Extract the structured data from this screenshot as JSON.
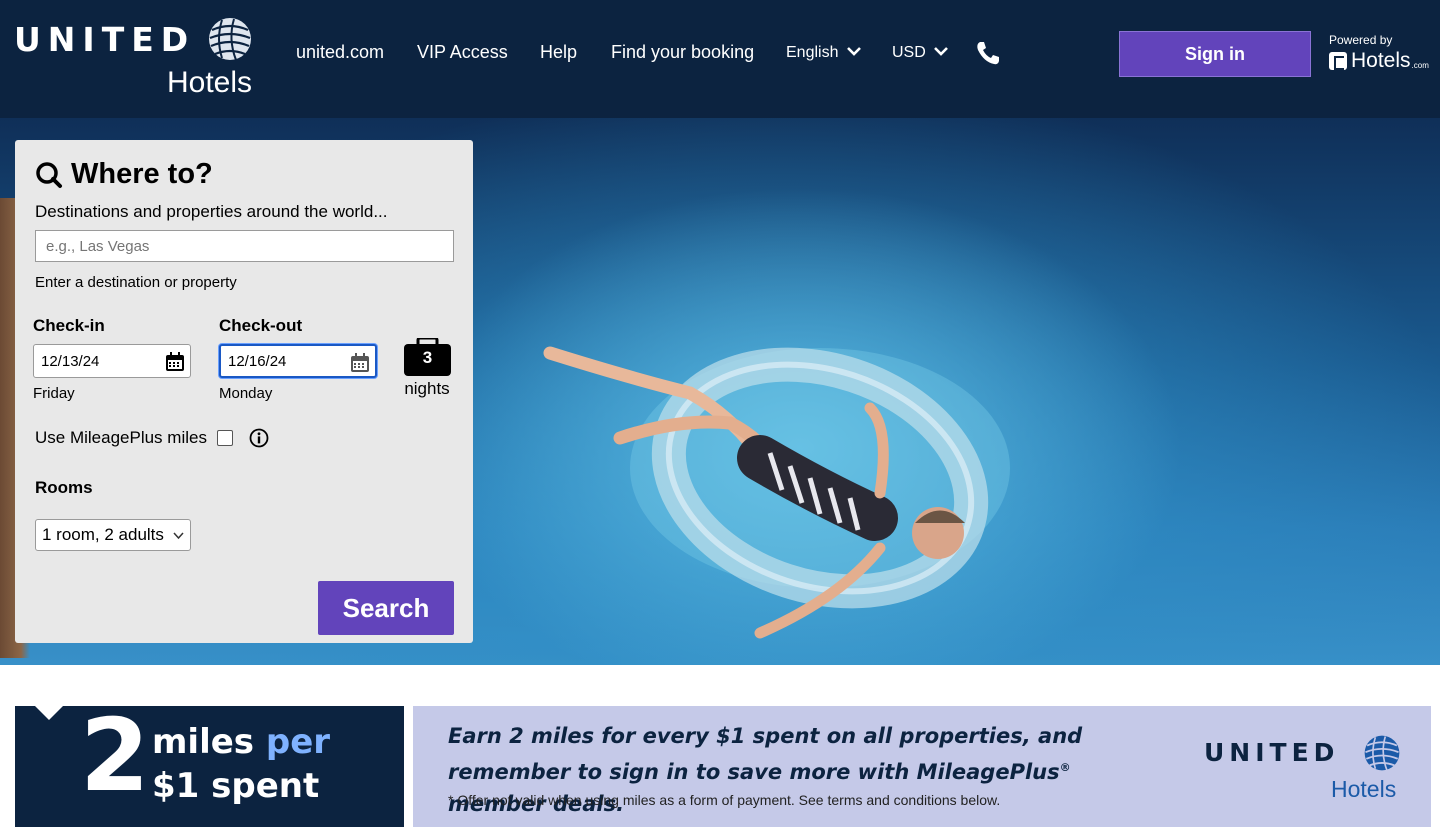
{
  "header": {
    "logo_word": "UNITED",
    "logo_sub": "Hotels",
    "nav": [
      {
        "label": "united.com"
      },
      {
        "label": "VIP Access"
      },
      {
        "label": "Help"
      },
      {
        "label": "Find your booking"
      }
    ],
    "language": "English",
    "currency": "USD",
    "signin_label": "Sign in",
    "powered_label": "Powered by",
    "powered_brand": "Hotels",
    "powered_suffix": ".com"
  },
  "search": {
    "title": "Where to?",
    "subtitle": "Destinations and properties around the world...",
    "placeholder": "e.g., Las Vegas",
    "value": "",
    "help": "Enter a destination or property",
    "checkin_label": "Check-in",
    "checkin_value": "12/13/24",
    "checkin_day": "Friday",
    "checkout_label": "Check-out",
    "checkout_value": "12/16/24",
    "checkout_day": "Monday",
    "nights_count": "3",
    "nights_label": "nights",
    "miles_label": "Use MileagePlus miles",
    "miles_checked": false,
    "rooms_label": "Rooms",
    "rooms_value": "1 room, 2 adults",
    "search_label": "Search"
  },
  "promo": {
    "big_number": "2",
    "line1_a": "miles",
    "line1_b": "per",
    "line2": "$1 spent",
    "text_a": "Earn 2 miles for every $1 spent on all properties, and remember to sign in to save more with MileagePlus",
    "text_reg": "®",
    "text_b": " member deals.",
    "note": "* Offer not valid when using miles as a form of payment. See terms and conditions below.",
    "logo_word": "UNITED",
    "logo_sub": "Hotels"
  },
  "colors": {
    "navy": "#0c2340",
    "purple": "#6244bb",
    "promo_bg": "#c5c9e8",
    "link_blue": "#1b5aa8"
  }
}
